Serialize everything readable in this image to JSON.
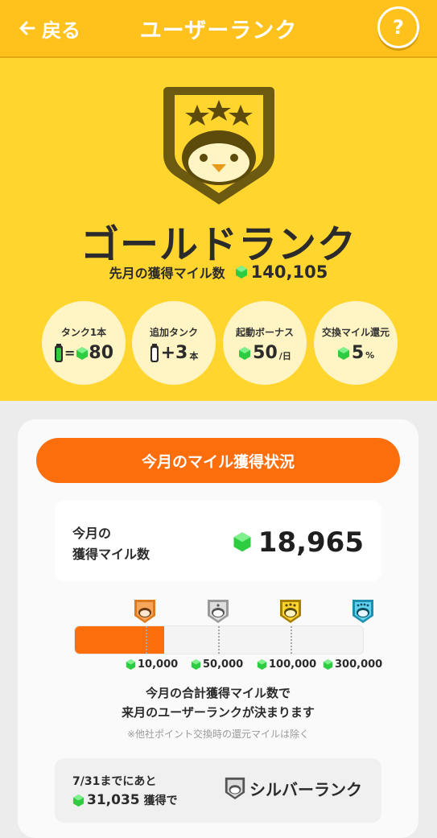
{
  "header": {
    "back_label": "戻る",
    "title": "ユーザーランク",
    "help_label": "?"
  },
  "rank": {
    "name": "ゴールドランク",
    "last_month_label": "先月の獲得マイル数",
    "last_month_value": "140,105",
    "badge_stars": 3
  },
  "perks": [
    {
      "label": "タンク1本",
      "value": "80",
      "prefix": "="
    },
    {
      "label": "追加タンク",
      "value": "+3",
      "unit": "本"
    },
    {
      "label": "起動ボーナス",
      "value": "50",
      "unit": "/日"
    },
    {
      "label": "交換マイル還元",
      "value": "5",
      "unit": "%"
    }
  ],
  "status": {
    "title": "今月のマイル獲得状況",
    "miles_label_line1": "今月の",
    "miles_label_line2": "獲得マイル数",
    "miles_value": "18,965",
    "progress_fraction": 0.31,
    "thresholds": [
      "10,000",
      "50,000",
      "100,000",
      "300,000"
    ],
    "note_line1": "今月の合計獲得マイル数で",
    "note_line2": "来月のユーザーランクが決まります",
    "note_small": "※他社ポイント交換時の還元マイルは除く"
  },
  "next": {
    "deadline": "7/31までにあと",
    "remaining_value": "31,035",
    "remaining_suffix": "獲得で",
    "rank_name": "シルバーランク"
  },
  "colors": {
    "header": "#ffc21c",
    "hero": "#ffd52e",
    "accent_orange": "#fc6d0c",
    "gem_green": "#2ecc40",
    "bronze": "#e07a1e",
    "silver": "#b8b8b8",
    "gold": "#e8b400",
    "platinum": "#3bb8d8"
  }
}
